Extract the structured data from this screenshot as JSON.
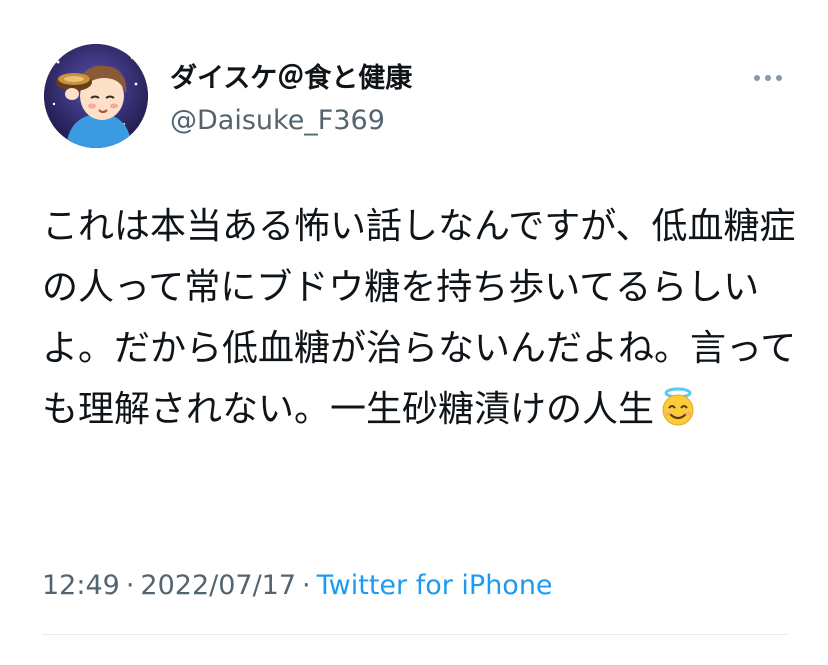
{
  "author": {
    "display_name": "ダイスケ＠食と健康",
    "handle": "@Daisuke_F369"
  },
  "tweet": {
    "text": "これは本当ある怖い話しなんですが、低血糖症の人って常にブドウ糖を持ち歩いてるらしいよ。だから低血糖が治らないんだよね。言っても理解されない。一生砂糖漬けの人生",
    "emoji": "smiling-face-with-halo-icon"
  },
  "meta": {
    "time": "12:49",
    "separator_1": "·",
    "date": "2022/07/17",
    "separator_2": "·",
    "source": "Twitter for iPhone"
  },
  "colors": {
    "text_primary": "#0f1419",
    "text_secondary": "#536471",
    "link": "#1d9bf0",
    "divider": "#e6ecf0"
  }
}
